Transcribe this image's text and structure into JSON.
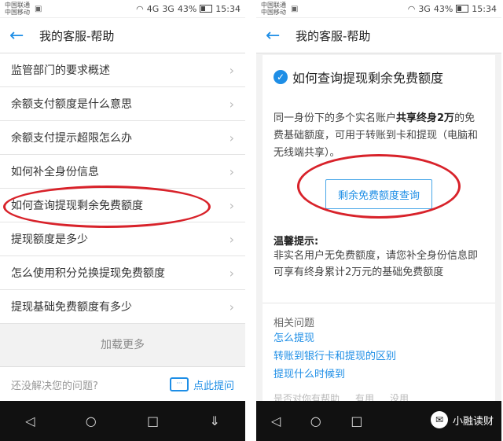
{
  "status": {
    "carrier_top": "中国联通",
    "carrier_bottom": "中国移动",
    "network": "4G",
    "signal": "3G",
    "battery": "43%",
    "time": "15:34"
  },
  "left": {
    "title": "我的客服-帮助",
    "items": [
      "监管部门的要求概述",
      "余额支付额度是什么意思",
      "余额支付提示超限怎么办",
      "如何补全身份信息",
      "如何查询提现剩余免费额度",
      "提现额度是多少",
      "怎么使用积分兑换提现免费额度",
      "提现基础免费额度有多少"
    ],
    "load_more": "加载更多",
    "ask_question": "还没解决您的问题?",
    "ask_link": "点此提问"
  },
  "right": {
    "title": "我的客服-帮助",
    "article_title": "如何查询提现剩余免费额度",
    "para_pre": "同一身份下的多个实名账户",
    "para_bold": "共享终身2万",
    "para_post": "的免费基础额度，可用于转账到卡和提现（电脑和无线端共享）。",
    "query_button": "剩余免费额度查询",
    "tip_heading": "温馨提示:",
    "tip_text": "非实名用户无免费额度，请您补全身份信息即可享有终身累计2万元的基础免费额度",
    "related_heading": "相关问题",
    "related": [
      "怎么提现",
      "转账到银行卡和提现的区别",
      "提现什么时候到"
    ],
    "helpful_question": "是否对你有帮助",
    "useful": "有用",
    "useless": "没用"
  },
  "watermark": "小融读财"
}
